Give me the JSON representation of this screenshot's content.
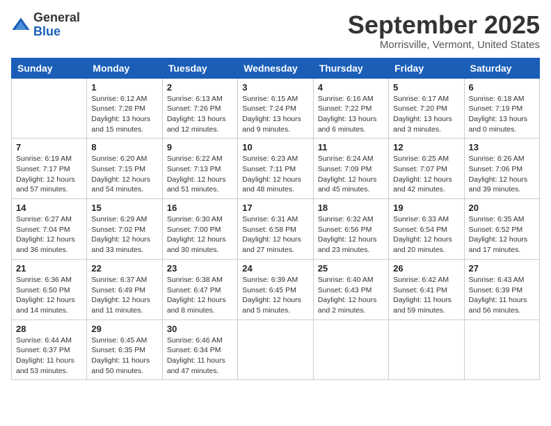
{
  "logo": {
    "general": "General",
    "blue": "Blue"
  },
  "title": "September 2025",
  "subtitle": "Morrisville, Vermont, United States",
  "days_of_week": [
    "Sunday",
    "Monday",
    "Tuesday",
    "Wednesday",
    "Thursday",
    "Friday",
    "Saturday"
  ],
  "weeks": [
    [
      {
        "day": "",
        "info": ""
      },
      {
        "day": "1",
        "info": "Sunrise: 6:12 AM\nSunset: 7:28 PM\nDaylight: 13 hours\nand 15 minutes."
      },
      {
        "day": "2",
        "info": "Sunrise: 6:13 AM\nSunset: 7:26 PM\nDaylight: 13 hours\nand 12 minutes."
      },
      {
        "day": "3",
        "info": "Sunrise: 6:15 AM\nSunset: 7:24 PM\nDaylight: 13 hours\nand 9 minutes."
      },
      {
        "day": "4",
        "info": "Sunrise: 6:16 AM\nSunset: 7:22 PM\nDaylight: 13 hours\nand 6 minutes."
      },
      {
        "day": "5",
        "info": "Sunrise: 6:17 AM\nSunset: 7:20 PM\nDaylight: 13 hours\nand 3 minutes."
      },
      {
        "day": "6",
        "info": "Sunrise: 6:18 AM\nSunset: 7:19 PM\nDaylight: 13 hours\nand 0 minutes."
      }
    ],
    [
      {
        "day": "7",
        "info": "Sunrise: 6:19 AM\nSunset: 7:17 PM\nDaylight: 12 hours\nand 57 minutes."
      },
      {
        "day": "8",
        "info": "Sunrise: 6:20 AM\nSunset: 7:15 PM\nDaylight: 12 hours\nand 54 minutes."
      },
      {
        "day": "9",
        "info": "Sunrise: 6:22 AM\nSunset: 7:13 PM\nDaylight: 12 hours\nand 51 minutes."
      },
      {
        "day": "10",
        "info": "Sunrise: 6:23 AM\nSunset: 7:11 PM\nDaylight: 12 hours\nand 48 minutes."
      },
      {
        "day": "11",
        "info": "Sunrise: 6:24 AM\nSunset: 7:09 PM\nDaylight: 12 hours\nand 45 minutes."
      },
      {
        "day": "12",
        "info": "Sunrise: 6:25 AM\nSunset: 7:07 PM\nDaylight: 12 hours\nand 42 minutes."
      },
      {
        "day": "13",
        "info": "Sunrise: 6:26 AM\nSunset: 7:06 PM\nDaylight: 12 hours\nand 39 minutes."
      }
    ],
    [
      {
        "day": "14",
        "info": "Sunrise: 6:27 AM\nSunset: 7:04 PM\nDaylight: 12 hours\nand 36 minutes."
      },
      {
        "day": "15",
        "info": "Sunrise: 6:29 AM\nSunset: 7:02 PM\nDaylight: 12 hours\nand 33 minutes."
      },
      {
        "day": "16",
        "info": "Sunrise: 6:30 AM\nSunset: 7:00 PM\nDaylight: 12 hours\nand 30 minutes."
      },
      {
        "day": "17",
        "info": "Sunrise: 6:31 AM\nSunset: 6:58 PM\nDaylight: 12 hours\nand 27 minutes."
      },
      {
        "day": "18",
        "info": "Sunrise: 6:32 AM\nSunset: 6:56 PM\nDaylight: 12 hours\nand 23 minutes."
      },
      {
        "day": "19",
        "info": "Sunrise: 6:33 AM\nSunset: 6:54 PM\nDaylight: 12 hours\nand 20 minutes."
      },
      {
        "day": "20",
        "info": "Sunrise: 6:35 AM\nSunset: 6:52 PM\nDaylight: 12 hours\nand 17 minutes."
      }
    ],
    [
      {
        "day": "21",
        "info": "Sunrise: 6:36 AM\nSunset: 6:50 PM\nDaylight: 12 hours\nand 14 minutes."
      },
      {
        "day": "22",
        "info": "Sunrise: 6:37 AM\nSunset: 6:49 PM\nDaylight: 12 hours\nand 11 minutes."
      },
      {
        "day": "23",
        "info": "Sunrise: 6:38 AM\nSunset: 6:47 PM\nDaylight: 12 hours\nand 8 minutes."
      },
      {
        "day": "24",
        "info": "Sunrise: 6:39 AM\nSunset: 6:45 PM\nDaylight: 12 hours\nand 5 minutes."
      },
      {
        "day": "25",
        "info": "Sunrise: 6:40 AM\nSunset: 6:43 PM\nDaylight: 12 hours\nand 2 minutes."
      },
      {
        "day": "26",
        "info": "Sunrise: 6:42 AM\nSunset: 6:41 PM\nDaylight: 11 hours\nand 59 minutes."
      },
      {
        "day": "27",
        "info": "Sunrise: 6:43 AM\nSunset: 6:39 PM\nDaylight: 11 hours\nand 56 minutes."
      }
    ],
    [
      {
        "day": "28",
        "info": "Sunrise: 6:44 AM\nSunset: 6:37 PM\nDaylight: 11 hours\nand 53 minutes."
      },
      {
        "day": "29",
        "info": "Sunrise: 6:45 AM\nSunset: 6:35 PM\nDaylight: 11 hours\nand 50 minutes."
      },
      {
        "day": "30",
        "info": "Sunrise: 6:46 AM\nSunset: 6:34 PM\nDaylight: 11 hours\nand 47 minutes."
      },
      {
        "day": "",
        "info": ""
      },
      {
        "day": "",
        "info": ""
      },
      {
        "day": "",
        "info": ""
      },
      {
        "day": "",
        "info": ""
      }
    ]
  ]
}
